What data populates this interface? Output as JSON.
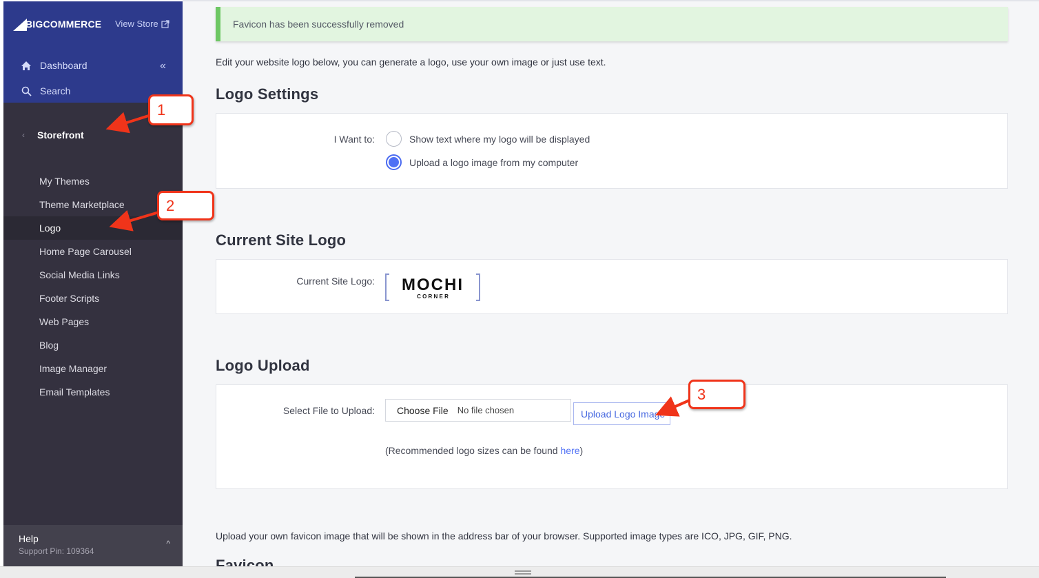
{
  "sidebar": {
    "brand": "BIGCOMMERCE",
    "brand_prefix": "BIG",
    "brand_suffix": "COMMERCE",
    "view_store": "View Store",
    "dashboard": "Dashboard",
    "search": "Search",
    "section": "Storefront",
    "items": [
      {
        "label": "My Themes",
        "active": false
      },
      {
        "label": "Theme Marketplace",
        "active": false
      },
      {
        "label": "Logo",
        "active": true
      },
      {
        "label": "Home Page Carousel",
        "active": false
      },
      {
        "label": "Social Media Links",
        "active": false
      },
      {
        "label": "Footer Scripts",
        "active": false
      },
      {
        "label": "Web Pages",
        "active": false
      },
      {
        "label": "Blog",
        "active": false
      },
      {
        "label": "Image Manager",
        "active": false
      },
      {
        "label": "Email Templates",
        "active": false
      }
    ],
    "help": {
      "title": "Help",
      "pin": "Support Pin: 109364"
    }
  },
  "main": {
    "alert": "Favicon has been successfully removed",
    "intro": "Edit your website logo below, you can generate a logo, use your own image or just use text.",
    "logo_settings": {
      "title": "Logo Settings",
      "label": "I Want to:",
      "options": [
        {
          "label": "Show text where my logo will be displayed",
          "checked": false
        },
        {
          "label": "Upload a logo image from my computer",
          "checked": true
        }
      ]
    },
    "current_logo": {
      "title": "Current Site Logo",
      "label": "Current Site Logo:",
      "logo_main": "MOCHI",
      "logo_sub": "C O R N E R"
    },
    "logo_upload": {
      "title": "Logo Upload",
      "label": "Select File to Upload:",
      "choose_file": "Choose File",
      "no_file": "No file chosen",
      "upload_button": "Upload Logo Image",
      "rec_prefix": "(Recommended logo sizes can be found ",
      "rec_link": "here",
      "rec_suffix": ")"
    },
    "favicon_note": "Upload your own favicon image that will be shown in the address bar of your browser. Supported image types are ICO, JPG, GIF, PNG.",
    "favicon_title": "Favicon"
  },
  "annotations": [
    {
      "number": "1"
    },
    {
      "number": "2"
    },
    {
      "number": "3"
    }
  ],
  "colors": {
    "sidebar_top": "#2d3a8c",
    "sidebar": "#34313f",
    "accent": "#4f70f5",
    "success": "#6dc764",
    "callout": "#f0341a"
  }
}
